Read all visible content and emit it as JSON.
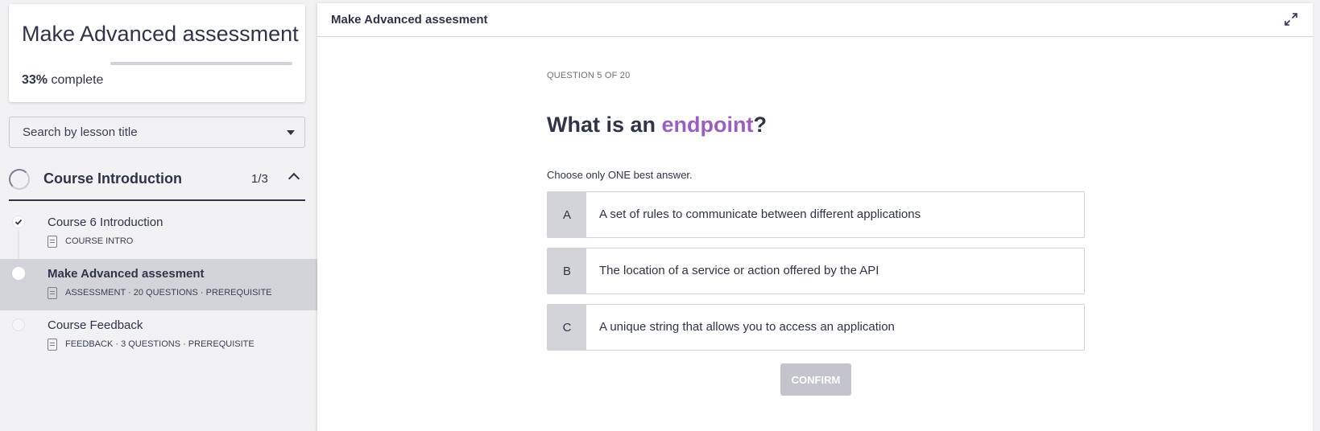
{
  "sidebar": {
    "course": {
      "title": "Make Advanced assessment",
      "progress_fraction": 0.0,
      "progress_percent": "33%",
      "progress_suffix": "complete"
    },
    "search": {
      "label": "Search by lesson title",
      "icon": "chevron-down-icon"
    },
    "section": {
      "title": "Course Introduction",
      "count": "1/3"
    },
    "lessons": [
      {
        "title": "Course 6 Introduction",
        "meta": "COURSE INTRO",
        "status": "complete"
      },
      {
        "title": "Make Advanced assesment",
        "meta": "ASSESSMENT · 20 QUESTIONS  ·  PREREQUISITE",
        "status": "active"
      },
      {
        "title": "Course Feedback",
        "meta": "FEEDBACK · 3 QUESTIONS  ·  PREREQUISITE",
        "status": "locked"
      }
    ]
  },
  "main": {
    "header_title": "Make Advanced assesment",
    "question_count": "QUESTION 5 OF 20",
    "question": {
      "prefix": "What is an ",
      "highlight": "endpoint",
      "suffix": "?"
    },
    "instruction": "Choose only ONE best answer.",
    "options": [
      {
        "letter": "A",
        "text": "A set of rules to communicate between different applications"
      },
      {
        "letter": "B",
        "text": "The location of a service or action offered by the API"
      },
      {
        "letter": "C",
        "text": "A unique string that allows you to access an application"
      }
    ],
    "confirm_label": "CONFIRM"
  },
  "colors": {
    "accent": "#9b5fbf",
    "dark": "#2f3448",
    "muted": "#d3d4da"
  }
}
